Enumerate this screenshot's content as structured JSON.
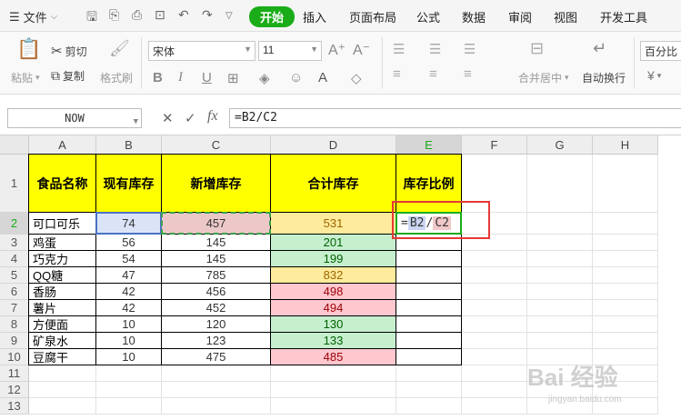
{
  "menubar": {
    "file_label": "文件",
    "tabs": [
      "开始",
      "插入",
      "页面布局",
      "公式",
      "数据",
      "审阅",
      "视图",
      "开发工具"
    ]
  },
  "ribbon": {
    "paste": "粘贴",
    "cut": "剪切",
    "copy": "复制",
    "format_painter": "格式刷",
    "font_name": "宋体",
    "font_size": "11",
    "bold": "B",
    "italic": "I",
    "underline": "U",
    "merge_center": "合并居中",
    "wrap_text": "自动换行",
    "number_format": "百分比",
    "currency": "¥"
  },
  "formula_bar": {
    "name_box": "NOW",
    "cancel": "✕",
    "confirm": "✓",
    "fx": "fx",
    "formula": "=B2/C2"
  },
  "columns": [
    "A",
    "B",
    "C",
    "D",
    "E",
    "F",
    "G",
    "H"
  ],
  "rows": [
    "1",
    "2",
    "3",
    "4",
    "5",
    "6",
    "7",
    "8",
    "9",
    "10",
    "11",
    "12",
    "13"
  ],
  "table": {
    "headers": [
      "食品名称",
      "现有库存",
      "新增库存",
      "合计库存",
      "库存比例"
    ],
    "data": [
      [
        "可口可乐",
        "74",
        "457",
        "531"
      ],
      [
        "鸡蛋",
        "56",
        "145",
        "201"
      ],
      [
        "巧克力",
        "54",
        "145",
        "199"
      ],
      [
        "QQ糖",
        "47",
        "785",
        "832"
      ],
      [
        "香肠",
        "42",
        "456",
        "498"
      ],
      [
        "薯片",
        "42",
        "452",
        "494"
      ],
      [
        "方便面",
        "10",
        "120",
        "130"
      ],
      [
        "矿泉水",
        "10",
        "123",
        "133"
      ],
      [
        "豆腐干",
        "10",
        "475",
        "485"
      ]
    ],
    "d_colors": [
      "yellow",
      "green",
      "green",
      "yellow",
      "red",
      "red",
      "green",
      "green",
      "red"
    ]
  },
  "edit_cell": {
    "eq": "=",
    "ref1": "B2",
    "op": "/",
    "ref2": "C2"
  },
  "watermark": {
    "main": "Bai 经验",
    "sub": "jingyan.baidu.com"
  }
}
